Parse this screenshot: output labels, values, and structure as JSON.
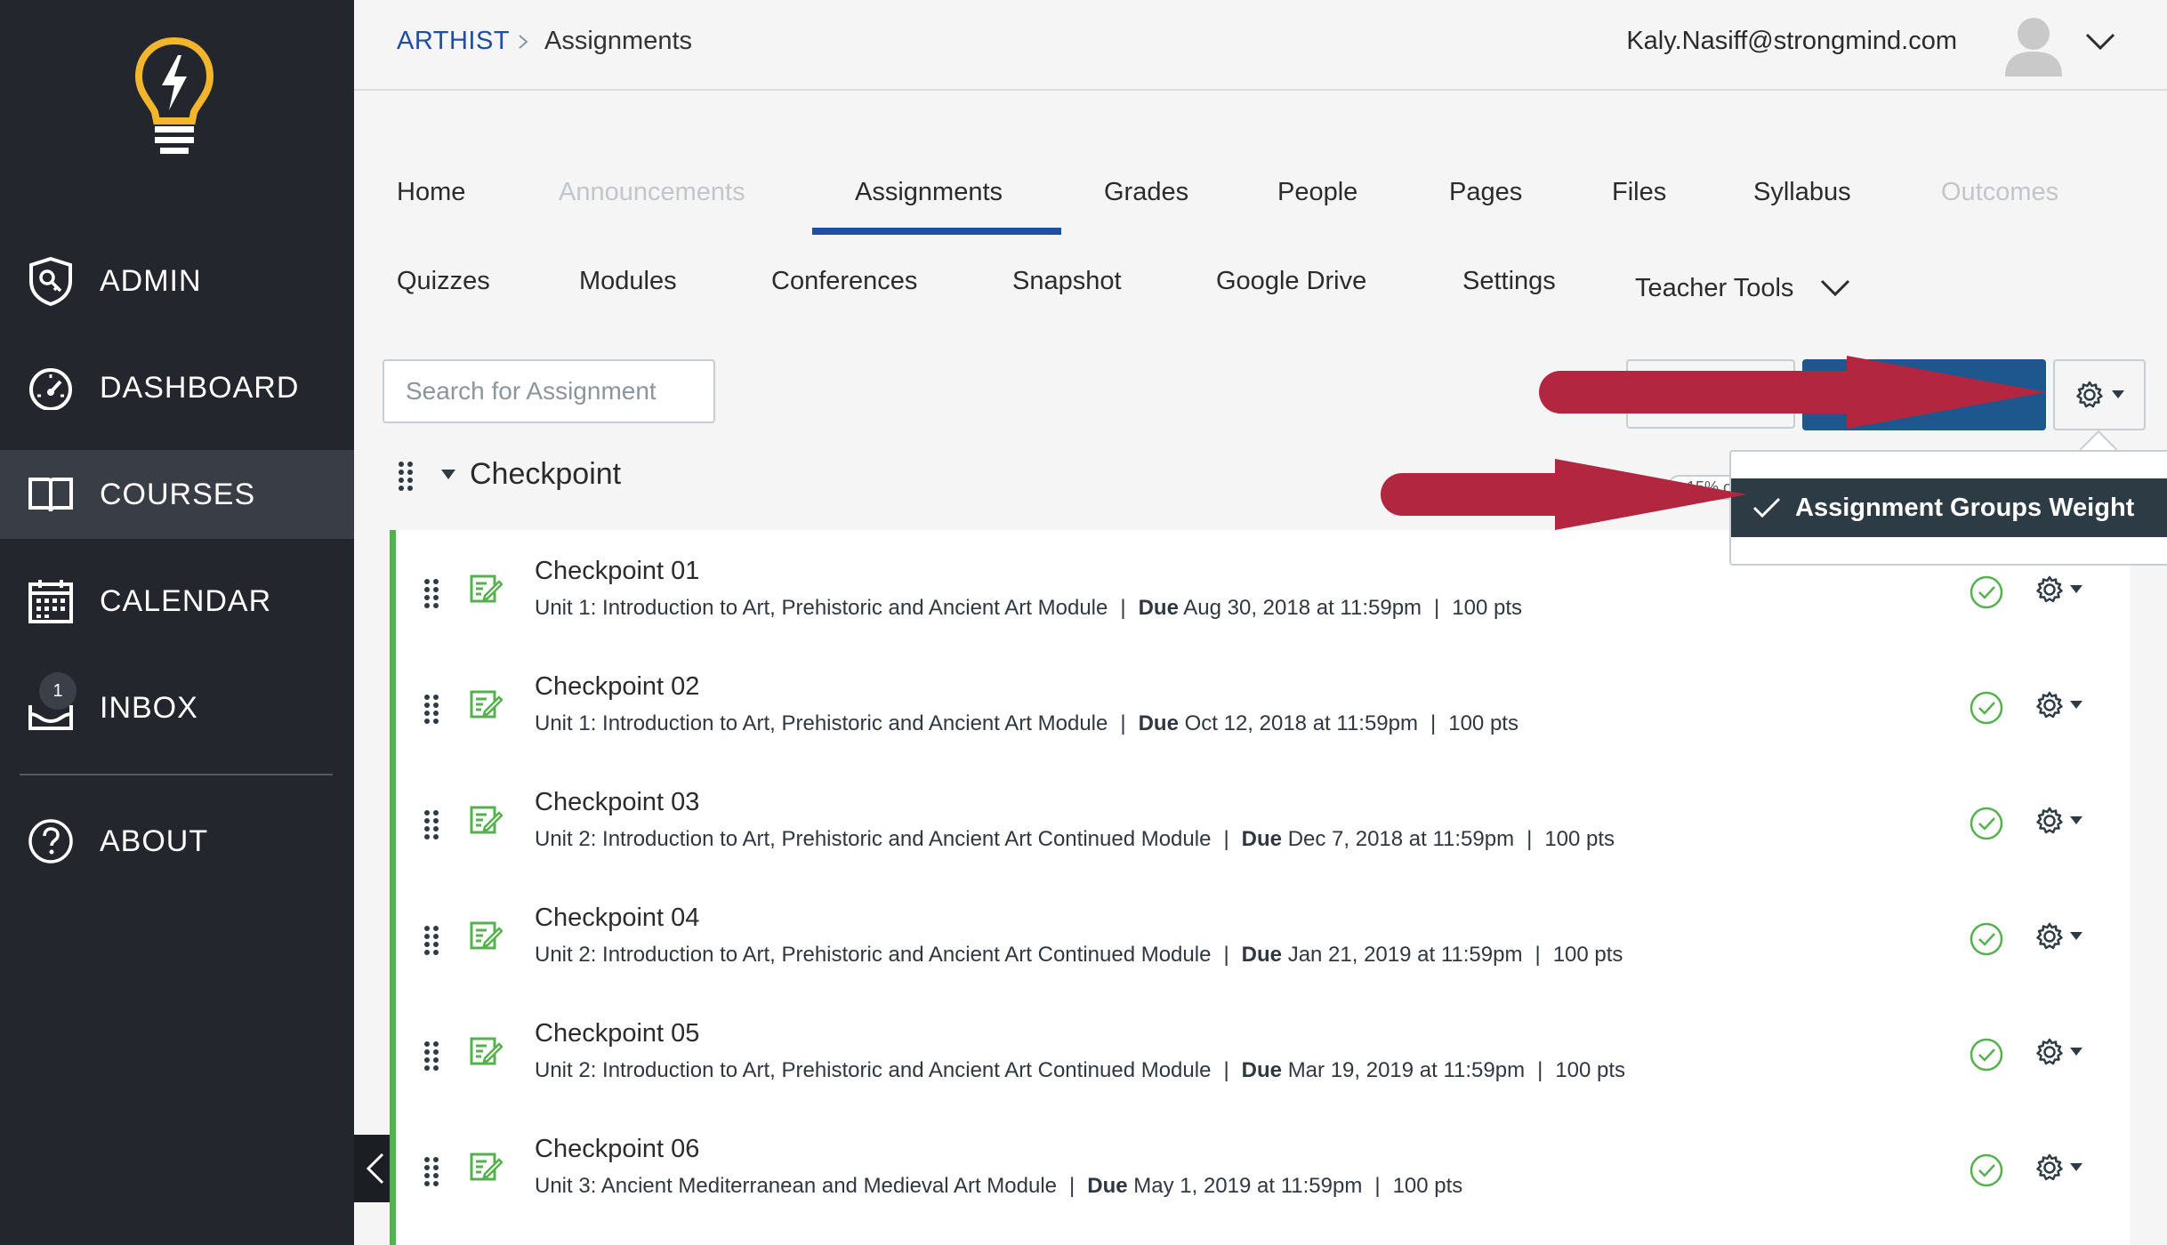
{
  "sidebar": {
    "items": [
      {
        "label": "ADMIN",
        "icon": "admin-shield-icon"
      },
      {
        "label": "DASHBOARD",
        "icon": "dashboard-gauge-icon"
      },
      {
        "label": "COURSES",
        "icon": "courses-book-icon"
      },
      {
        "label": "CALENDAR",
        "icon": "calendar-icon"
      },
      {
        "label": "INBOX",
        "icon": "inbox-tray-icon"
      },
      {
        "label": "ABOUT",
        "icon": "help-circle-icon"
      }
    ],
    "inbox_badge": "1",
    "active_item": "COURSES"
  },
  "breadcrumb": {
    "course": "ARTHIST",
    "current": "Assignments"
  },
  "user": {
    "email": "Kaly.Nasiff@strongmind.com"
  },
  "tabs": {
    "row1": [
      {
        "label": "Home"
      },
      {
        "label": "Announcements"
      },
      {
        "label": "Assignments"
      },
      {
        "label": "Grades"
      },
      {
        "label": "People"
      },
      {
        "label": "Pages"
      },
      {
        "label": "Files"
      },
      {
        "label": "Syllabus"
      },
      {
        "label": "Outcomes"
      }
    ],
    "row2": [
      {
        "label": "Quizzes"
      },
      {
        "label": "Modules"
      },
      {
        "label": "Conferences"
      },
      {
        "label": "Snapshot"
      },
      {
        "label": "Google Drive"
      },
      {
        "label": "Settings"
      },
      {
        "label": "Teacher Tools"
      }
    ],
    "active": "Assignments",
    "disabled": [
      "Announcements",
      "Outcomes"
    ]
  },
  "search": {
    "placeholder": "Search for Assignment"
  },
  "group": {
    "name": "Checkpoint",
    "weight_partial": "15% o"
  },
  "dropdown": {
    "item_label": "Assignment Groups Weight",
    "checked": true
  },
  "assignments": [
    {
      "title": "Checkpoint 01",
      "module": "Unit 1: Introduction to Art, Prehistoric and Ancient Art Module",
      "due_label": "Due",
      "due": "Aug 30, 2018 at 11:59pm",
      "points": "100 pts"
    },
    {
      "title": "Checkpoint 02",
      "module": "Unit 1: Introduction to Art, Prehistoric and Ancient Art Module",
      "due_label": "Due",
      "due": "Oct 12, 2018 at 11:59pm",
      "points": "100 pts"
    },
    {
      "title": "Checkpoint 03",
      "module": "Unit 2: Introduction to Art, Prehistoric and Ancient Art Continued Module",
      "due_label": "Due",
      "due": "Dec 7, 2018 at 11:59pm",
      "points": "100 pts"
    },
    {
      "title": "Checkpoint 04",
      "module": "Unit 2: Introduction to Art, Prehistoric and Ancient Art Continued Module",
      "due_label": "Due",
      "due": "Jan 21, 2019 at 11:59pm",
      "points": "100 pts"
    },
    {
      "title": "Checkpoint 05",
      "module": "Unit 2: Introduction to Art, Prehistoric and Ancient Art Continued Module",
      "due_label": "Due",
      "due": "Mar 19, 2019 at 11:59pm",
      "points": "100 pts"
    },
    {
      "title": "Checkpoint 06",
      "module": "Unit 3: Ancient Mediterranean and Medieval Art Module",
      "due_label": "Due",
      "due": "May 1, 2019 at 11:59pm",
      "points": "100 pts"
    }
  ],
  "colors": {
    "sidebar_bg": "#23272d",
    "sidebar_active": "#393e46",
    "accent_blue": "#1f4fa3",
    "primary_button": "#1d578e",
    "published_green": "#56b04d",
    "annotation_arrow": "#b22640",
    "logo_yellow": "#f3b52b"
  }
}
